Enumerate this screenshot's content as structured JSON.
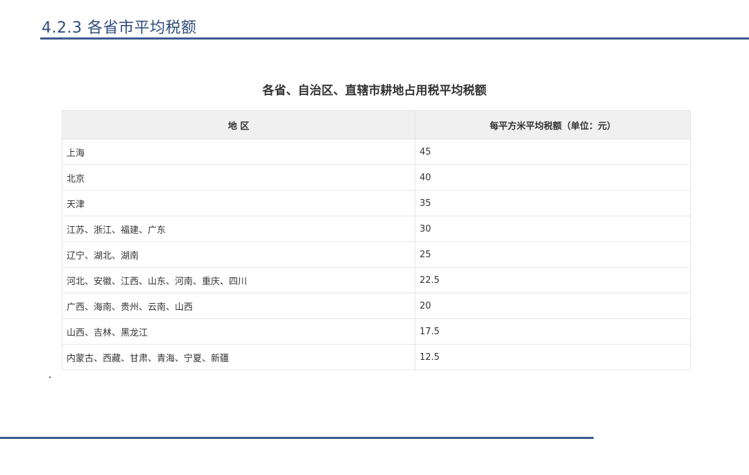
{
  "heading": "4.2.3 各省市平均税额",
  "table": {
    "title": "各省、自治区、直辖市耕地占用税平均税额",
    "columns": [
      "地 区",
      "每平方米平均税额（单位：元）"
    ],
    "rows": [
      [
        "上海",
        "45"
      ],
      [
        "北京",
        "40"
      ],
      [
        "天津",
        "35"
      ],
      [
        "江苏、浙江、福建、广东",
        "30"
      ],
      [
        "辽宁、湖北、湖南",
        "25"
      ],
      [
        "河北、安徽、江西、山东、河南、重庆、四川",
        "22.5"
      ],
      [
        "广西、海南、贵州、云南、山西",
        "20"
      ],
      [
        "山西、吉林、黑龙江",
        "17.5"
      ],
      [
        "内蒙古、西藏、甘肃、青海、宁夏、新疆",
        "12.5"
      ]
    ]
  },
  "colors": {
    "accent": "#3b5a8e",
    "heading_text": "#2f4b7c",
    "header_bg": "#f0f0f0"
  }
}
